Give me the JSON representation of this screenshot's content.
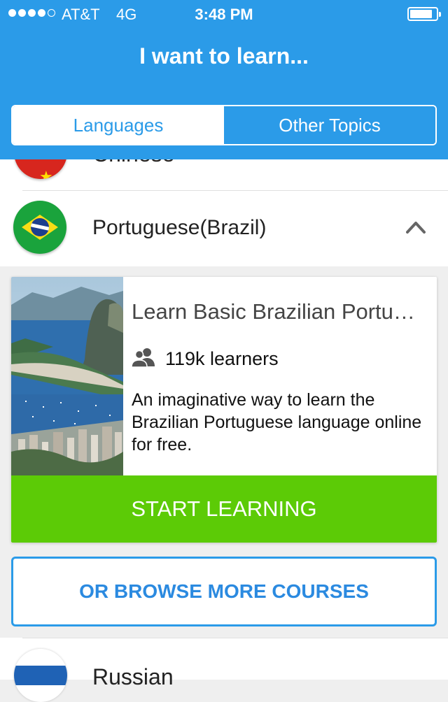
{
  "status_bar": {
    "carrier": "AT&T",
    "network": "4G",
    "time": "3:48 PM",
    "battery_level": 0.85,
    "signal_bars": 4
  },
  "header": {
    "title": "I want to learn..."
  },
  "tabs": [
    {
      "label": "Languages",
      "active": true
    },
    {
      "label": "Other Topics",
      "active": false
    }
  ],
  "languages": [
    {
      "label": "Chinese",
      "flag_icon": "china-flag-icon"
    },
    {
      "label": "Portuguese(Brazil)",
      "flag_icon": "brazil-flag-icon",
      "expanded": true
    },
    {
      "label": "Russian",
      "flag_icon": "russia-flag-icon"
    }
  ],
  "course": {
    "title": "Learn Basic Brazilian Portuguese",
    "learners": "119k learners",
    "description": "An imaginative way to learn the Brazilian Portuguese language online for free.",
    "start_label": "START LEARNING"
  },
  "browse_label": "OR BROWSE MORE COURSES",
  "colors": {
    "primary": "#2b9be8",
    "start_button": "#5ccb06",
    "background": "#efefef"
  }
}
